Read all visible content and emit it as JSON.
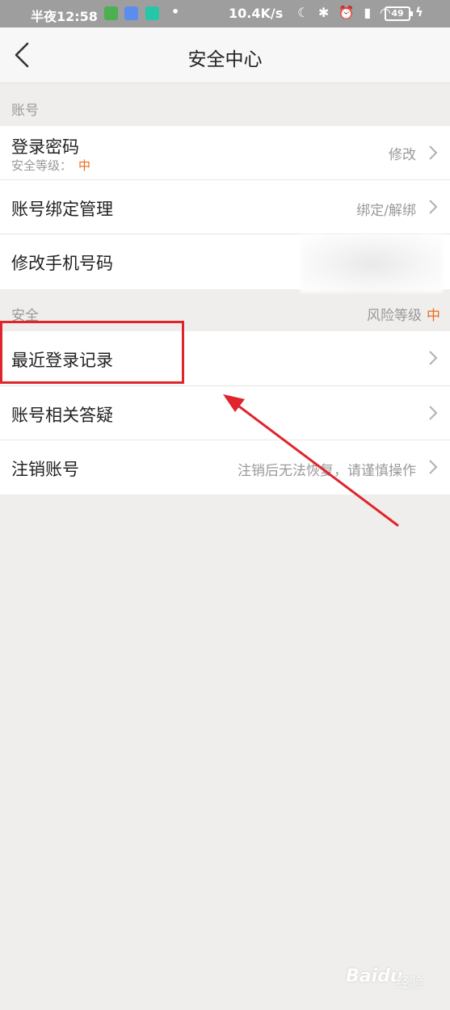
{
  "status_bar": {
    "time": "半夜12:58",
    "network_speed": "10.4K/s",
    "battery": "49",
    "indicator_icons": "☾ ✱ ⏰ ▮ ◠"
  },
  "header": {
    "title": "安全中心"
  },
  "account_section": {
    "label": "账号",
    "login_password": {
      "title": "登录密码",
      "sub_label": "安全等级：",
      "sub_level": "中",
      "action": "修改"
    },
    "binding": {
      "title": "账号绑定管理",
      "action": "绑定/解绑"
    },
    "change_phone": {
      "title": "修改手机号码"
    }
  },
  "security_section": {
    "label": "安全",
    "risk_label": "风险等级",
    "risk_level": "中",
    "recent_login": {
      "title": "最近登录记录"
    },
    "faq": {
      "title": "账号相关答疑"
    },
    "cancel_account": {
      "title": "注销账号",
      "note": "注销后无法恢复，请谨慎操作"
    }
  },
  "watermark": {
    "brand": "Baidu",
    "sub": "经验"
  },
  "colors": {
    "accent_orange": "#ee6a1a",
    "highlight_red": "#e0242c",
    "background": "#efeeed"
  }
}
